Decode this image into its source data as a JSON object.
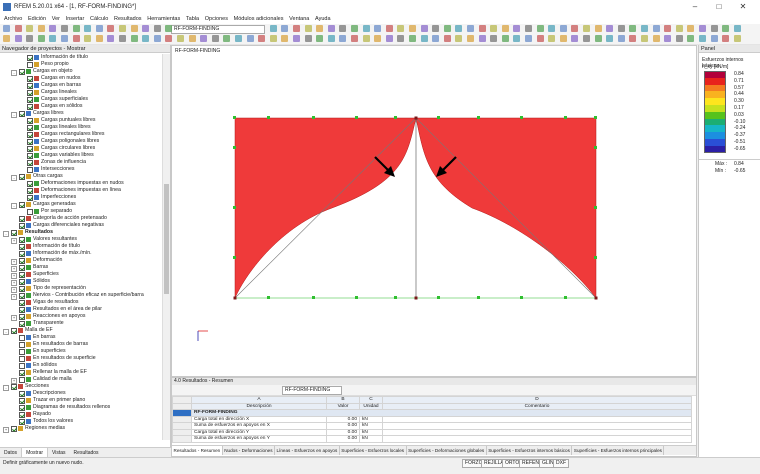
{
  "app": {
    "title": "RFEM 5.20.01 x64 - [1, RF-FORM-FINDING*]"
  },
  "window_controls": {
    "minimize": "–",
    "maximize": "□",
    "close": "✕"
  },
  "menu": [
    "Archivo",
    "Edición",
    "Ver",
    "Insertar",
    "Cálculo",
    "Resultados",
    "Herramientas",
    "Tabla",
    "Opciones",
    "Módulos adicionales",
    "Ventana",
    "Ayuda"
  ],
  "toolbar": {
    "module_select": "RF-FORM-FINDING"
  },
  "navigator": {
    "title": "Navegador de proyectos - Mostrar",
    "items": [
      {
        "label": "Información de título",
        "indent": 2,
        "exp": "",
        "cb": "on"
      },
      {
        "label": "Peso propio",
        "indent": 2,
        "exp": "",
        "cb": "off"
      },
      {
        "label": "Cargas en objeto",
        "indent": 1,
        "exp": "-",
        "cb": "on"
      },
      {
        "label": "Cargas en nudos",
        "indent": 2,
        "exp": "",
        "cb": "on"
      },
      {
        "label": "Cargas en barras",
        "indent": 2,
        "exp": "",
        "cb": "on"
      },
      {
        "label": "Cargas lineales",
        "indent": 2,
        "exp": "",
        "cb": "on"
      },
      {
        "label": "Cargas superficiales",
        "indent": 2,
        "exp": "",
        "cb": "on"
      },
      {
        "label": "Cargas en sólidos",
        "indent": 2,
        "exp": "",
        "cb": "on"
      },
      {
        "label": "Cargas libres",
        "indent": 1,
        "exp": "-",
        "cb": "on"
      },
      {
        "label": "Cargas puntuales libres",
        "indent": 2,
        "exp": "",
        "cb": "on"
      },
      {
        "label": "Cargas lineales libres",
        "indent": 2,
        "exp": "",
        "cb": "on"
      },
      {
        "label": "Cargas rectangulares libres",
        "indent": 2,
        "exp": "",
        "cb": "on"
      },
      {
        "label": "Cargas poligonales libres",
        "indent": 2,
        "exp": "",
        "cb": "on"
      },
      {
        "label": "Cargas circulares libres",
        "indent": 2,
        "exp": "",
        "cb": "on"
      },
      {
        "label": "Cargas variables libres",
        "indent": 2,
        "exp": "",
        "cb": "on"
      },
      {
        "label": "Zonas de influencia",
        "indent": 2,
        "exp": "",
        "cb": "on"
      },
      {
        "label": "Intersecciones",
        "indent": 2,
        "exp": "",
        "cb": "off"
      },
      {
        "label": "Otras cargas",
        "indent": 1,
        "exp": "-",
        "cb": "on"
      },
      {
        "label": "Deformaciones impuestas en nudos",
        "indent": 2,
        "exp": "",
        "cb": "on"
      },
      {
        "label": "Deformaciones impuestas en línea",
        "indent": 2,
        "exp": "",
        "cb": "on"
      },
      {
        "label": "Imperfecciones",
        "indent": 2,
        "exp": "",
        "cb": "on"
      },
      {
        "label": "Cargas generadas",
        "indent": 1,
        "exp": "-",
        "cb": "on"
      },
      {
        "label": "Por separado",
        "indent": 2,
        "exp": "",
        "cb": "off"
      },
      {
        "label": "Categoría de acción pretensado",
        "indent": 1,
        "exp": "",
        "cb": "on"
      },
      {
        "label": "Cargas diferenciales negativas",
        "indent": 1,
        "exp": "",
        "cb": "on"
      },
      {
        "label": "Resultados",
        "indent": 0,
        "exp": "-",
        "cb": "on",
        "bold": true
      },
      {
        "label": "Valores resultantes",
        "indent": 1,
        "exp": "+",
        "cb": "on"
      },
      {
        "label": "Información de título",
        "indent": 1,
        "exp": "",
        "cb": "on"
      },
      {
        "label": "Información de máx./mín.",
        "indent": 1,
        "exp": "",
        "cb": "on"
      },
      {
        "label": "Deformación",
        "indent": 1,
        "exp": "+",
        "cb": "on"
      },
      {
        "label": "Barras",
        "indent": 1,
        "exp": "+",
        "cb": "on"
      },
      {
        "label": "Superficies",
        "indent": 1,
        "exp": "+",
        "cb": "on"
      },
      {
        "label": "Sólidos",
        "indent": 1,
        "exp": "+",
        "cb": "on"
      },
      {
        "label": "Tipo de representación",
        "indent": 1,
        "exp": "+",
        "cb": "on"
      },
      {
        "label": "Nervios - Contribución eficaz en superficie/barra",
        "indent": 1,
        "exp": "+",
        "cb": "on"
      },
      {
        "label": "Vigas de resultados",
        "indent": 1,
        "exp": "",
        "cb": "on"
      },
      {
        "label": "Resultados en el área de pilar",
        "indent": 1,
        "exp": "",
        "cb": "on"
      },
      {
        "label": "Reacciones en apoyos",
        "indent": 1,
        "exp": "+",
        "cb": "on"
      },
      {
        "label": "Transparente",
        "indent": 1,
        "exp": "",
        "cb": "on"
      },
      {
        "label": "Malla de EF",
        "indent": 0,
        "exp": "-",
        "cb": "on"
      },
      {
        "label": "En barras",
        "indent": 1,
        "exp": "",
        "cb": "off"
      },
      {
        "label": "En resultados de barras",
        "indent": 1,
        "exp": "",
        "cb": "off"
      },
      {
        "label": "En superficies",
        "indent": 1,
        "exp": "",
        "cb": "off"
      },
      {
        "label": "En resultados de superficie",
        "indent": 1,
        "exp": "",
        "cb": "off"
      },
      {
        "label": "En sólidos",
        "indent": 1,
        "exp": "",
        "cb": "off"
      },
      {
        "label": "Rellenar la malla de EF",
        "indent": 1,
        "exp": "",
        "cb": "on"
      },
      {
        "label": "Calidad de malla",
        "indent": 1,
        "exp": "+",
        "cb": "off"
      },
      {
        "label": "Secciones",
        "indent": 0,
        "exp": "-",
        "cb": "on"
      },
      {
        "label": "Descripciones",
        "indent": 1,
        "exp": "",
        "cb": "on"
      },
      {
        "label": "Trazar en primer plano",
        "indent": 1,
        "exp": "",
        "cb": "on"
      },
      {
        "label": "Diagramas de resultados rellenos",
        "indent": 1,
        "exp": "",
        "cb": "on"
      },
      {
        "label": "Rayado",
        "indent": 1,
        "exp": "",
        "cb": "on"
      },
      {
        "label": "Todos los valores",
        "indent": 1,
        "exp": "",
        "cb": "on"
      },
      {
        "label": "Regiones medias",
        "indent": 0,
        "exp": "+",
        "cb": "on"
      }
    ],
    "tabs": [
      "Datos",
      "Mostrar",
      "Vistas",
      "Resultados"
    ]
  },
  "canvas": {
    "label": "RF-FORM-FINDING"
  },
  "panel": {
    "title": "Panel",
    "heading": "Esfuerzos internos básicos",
    "unit": "n_xy [kN/m]",
    "legend": [
      {
        "value": "0.84",
        "color": "#b2003a"
      },
      {
        "value": "0.71",
        "color": "#e8231c"
      },
      {
        "value": "0.57",
        "color": "#f47b20"
      },
      {
        "value": "0.44",
        "color": "#f9b21f"
      },
      {
        "value": "0.30",
        "color": "#fde51e"
      },
      {
        "value": "0.17",
        "color": "#c6e11e"
      },
      {
        "value": "0.03",
        "color": "#56c21c"
      },
      {
        "value": "-0.10",
        "color": "#1cae72"
      },
      {
        "value": "-0.24",
        "color": "#16b6c7"
      },
      {
        "value": "-0.37",
        "color": "#1c8fe0"
      },
      {
        "value": "-0.51",
        "color": "#2a4fd6"
      },
      {
        "value": "-0.65",
        "color": "#2b1fa6"
      }
    ],
    "max_label": "Máx :",
    "max_value": "0.84",
    "min_label": "Mín :",
    "min_value": "-0.65"
  },
  "results": {
    "title": "4.0 Resultados - Resumen",
    "dropdown": "RF-FORM-FINDING",
    "col_letters": [
      "A",
      "B",
      "C",
      "D"
    ],
    "columns": [
      "Descripción",
      "Valor",
      "Unidad",
      "Comentario"
    ],
    "group": "RF-FORM-FINDING",
    "rows": [
      {
        "desc": "Carga total en dirección X",
        "value": "0.00",
        "unit": "kN"
      },
      {
        "desc": "Suma de esfuerzos en apoyos en X",
        "value": "0.00",
        "unit": "kN"
      },
      {
        "desc": "Carga total en dirección Y",
        "value": "0.00",
        "unit": "kN"
      },
      {
        "desc": "Suma de esfuerzos en apoyos en Y",
        "value": "0.00",
        "unit": "kN"
      }
    ],
    "tabs": [
      "Resultados - Resumen",
      "Nudos - Deformaciones",
      "Líneas - Esfuerzos en apoyos",
      "Superficies - Esfuerzos locales",
      "Superficies - Deformaciones globales",
      "Superficies - Esfuerzos internos básicos",
      "Superficies - Esfuerzos internos principales"
    ]
  },
  "statusbar": {
    "message": "Definir gráficamente un nuevo nudo.",
    "buttons": [
      "FORZC",
      "REJILLA",
      "ORTO",
      "REFENT",
      "GLIN",
      "DXF"
    ]
  },
  "colors": {
    "shape_fill": "#ef3a3a",
    "node": "#2fbf2f",
    "accent": "#1f5fb8"
  }
}
